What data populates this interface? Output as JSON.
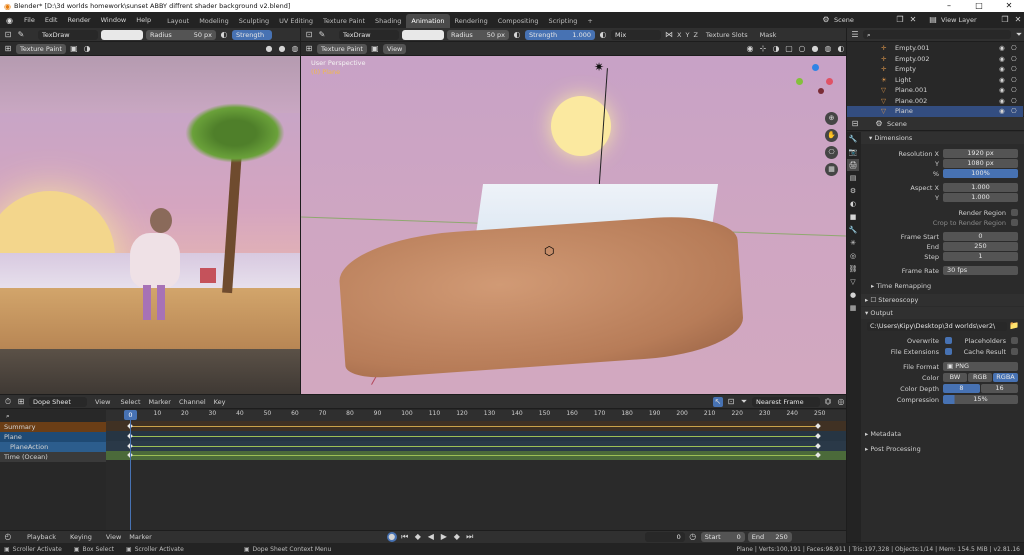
{
  "window": {
    "title": "Blender* [D:\\3d worlds homework\\sunset ABBY diffrent shader background v2.blend]",
    "minimize": "–",
    "maximize": "□",
    "close": "✕"
  },
  "menu": [
    "File",
    "Edit",
    "Render",
    "Window",
    "Help"
  ],
  "workspaces": [
    "Layout",
    "Modeling",
    "Sculpting",
    "UV Editing",
    "Texture Paint",
    "Shading",
    "Animation",
    "Rendering",
    "Compositing",
    "Scripting",
    "+"
  ],
  "active_workspace": "Animation",
  "scene": {
    "name": "Scene",
    "view_layer": "View Layer"
  },
  "left_view": {
    "mode": "Texture Paint",
    "brush": "TexDraw",
    "radius_label": "Radius",
    "radius_value": "50 px",
    "strength_label": "Strength"
  },
  "main_view": {
    "mode": "Texture Paint",
    "view_menu": "View",
    "brush": "TexDraw",
    "radius_label": "Radius",
    "radius_value": "50 px",
    "strength_label": "Strength",
    "strength_value": "1.000",
    "blend": "Mix",
    "texture_slots": "Texture Slots",
    "mask": "Mask",
    "axes": [
      "X",
      "Y",
      "Z"
    ],
    "overlay_title": "User Perspective",
    "overlay_sub": "(0) Plane"
  },
  "outliner": [
    {
      "name": "Empty.001",
      "icon": "empty-icon"
    },
    {
      "name": "Empty.002",
      "icon": "empty-icon"
    },
    {
      "name": "Empty",
      "icon": "empty-icon"
    },
    {
      "name": "Light",
      "icon": "light-icon"
    },
    {
      "name": "Plane.001",
      "icon": "mesh-icon"
    },
    {
      "name": "Plane.002",
      "icon": "mesh-icon"
    },
    {
      "name": "Plane",
      "icon": "mesh-icon",
      "selected": true
    }
  ],
  "properties": {
    "context": "Scene",
    "dimensions": "Dimensions",
    "resolution_x_label": "Resolution X",
    "resolution_x": "1920 px",
    "resolution_y_label": "Y",
    "resolution_y": "1080 px",
    "percent_label": "%",
    "percent": "100%",
    "aspect_x_label": "Aspect X",
    "aspect_x": "1.000",
    "aspect_y_label": "Y",
    "aspect_y": "1.000",
    "render_region": "Render Region",
    "crop": "Crop to Render Region",
    "frame_start_label": "Frame Start",
    "frame_start": "0",
    "end_label": "End",
    "end": "250",
    "step_label": "Step",
    "step": "1",
    "frame_rate_label": "Frame Rate",
    "frame_rate": "30 fps",
    "time_remapping": "Time Remapping",
    "stereoscopy": "Stereoscopy",
    "output": "Output",
    "output_path": "C:\\Users\\Kipy\\Desktop\\3d worlds\\ver2\\",
    "overwrite": "Overwrite",
    "placeholders": "Placeholders",
    "file_extensions": "File Extensions",
    "cache_result": "Cache Result",
    "file_format_label": "File Format",
    "file_format": "PNG",
    "color_label": "Color",
    "color_opts": [
      "BW",
      "RGB",
      "RGBA"
    ],
    "color_depth_label": "Color Depth",
    "color_depth": [
      "8",
      "16"
    ],
    "compression_label": "Compression",
    "compression": "15%",
    "metadata": "Metadata",
    "post_processing": "Post Processing"
  },
  "dopesheet": {
    "mode": "Dope Sheet",
    "menus": [
      "View",
      "Select",
      "Marker",
      "Channel",
      "Key"
    ],
    "interp": "Nearest Frame",
    "frames": [
      "0",
      "10",
      "20",
      "30",
      "40",
      "50",
      "60",
      "70",
      "80",
      "90",
      "100",
      "110",
      "120",
      "130",
      "140",
      "150",
      "160",
      "170",
      "180",
      "190",
      "200",
      "210",
      "220",
      "230",
      "240",
      "250"
    ],
    "current_frame": "0",
    "channels": [
      {
        "name": "Summary",
        "color": "#6b3e16"
      },
      {
        "name": "Plane",
        "color": "#1f4a74"
      },
      {
        "name": "PlaneAction",
        "color": "#2c5d8d"
      },
      {
        "name": "Time (Ocean)",
        "color": "#3a3a3a"
      }
    ]
  },
  "timeline": {
    "menus": [
      "Playback",
      "Keying",
      "View",
      "Marker"
    ],
    "frame": "0",
    "start_label": "Start",
    "start": "0",
    "end_label": "End",
    "end": "250"
  },
  "statusbar": {
    "left": [
      "Scroller Activate",
      "Box Select",
      "Scroller Activate",
      "Dope Sheet Context Menu"
    ],
    "right": "Plane | Verts:100,191 | Faces:98,911 | Tris:197,328 | Objects:1/14 | Mem: 154.5 MiB | v2.81.16"
  },
  "colors": {
    "accent": "#4772b3",
    "header": "#303030",
    "bg": "#1d1d1d"
  }
}
